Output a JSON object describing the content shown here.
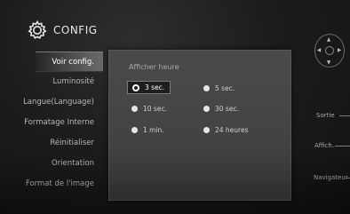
{
  "header": {
    "title": "CONFIG",
    "icon": "gear-icon"
  },
  "menu": {
    "items": [
      {
        "label": "Voir config.",
        "active": true
      },
      {
        "label": "Luminosité",
        "active": false
      },
      {
        "label": "Langue(Language)",
        "active": false
      },
      {
        "label": "Formatage Interne",
        "active": false
      },
      {
        "label": "Réinitialiser",
        "active": false
      },
      {
        "label": "Orientation",
        "active": false
      },
      {
        "label": "Format de l'image",
        "active": false
      }
    ]
  },
  "panel": {
    "label": "Afficher heure",
    "options": [
      {
        "label": "3 sec.",
        "selected": true
      },
      {
        "label": "5 sec.",
        "selected": false
      },
      {
        "label": "10 sec.",
        "selected": false
      },
      {
        "label": "30 sec.",
        "selected": false
      },
      {
        "label": "1 min.",
        "selected": false
      },
      {
        "label": "24 heures",
        "selected": false
      }
    ]
  },
  "side": {
    "nav_icon": "navigation-pad-icon",
    "sortie": "Sortie",
    "affich": "Affich.",
    "navigateur": "Navigateur"
  },
  "colors": {
    "panel_bg": "#444444",
    "selected_bg": "#1e1e1e",
    "active_menu": "#5a5a5a"
  }
}
